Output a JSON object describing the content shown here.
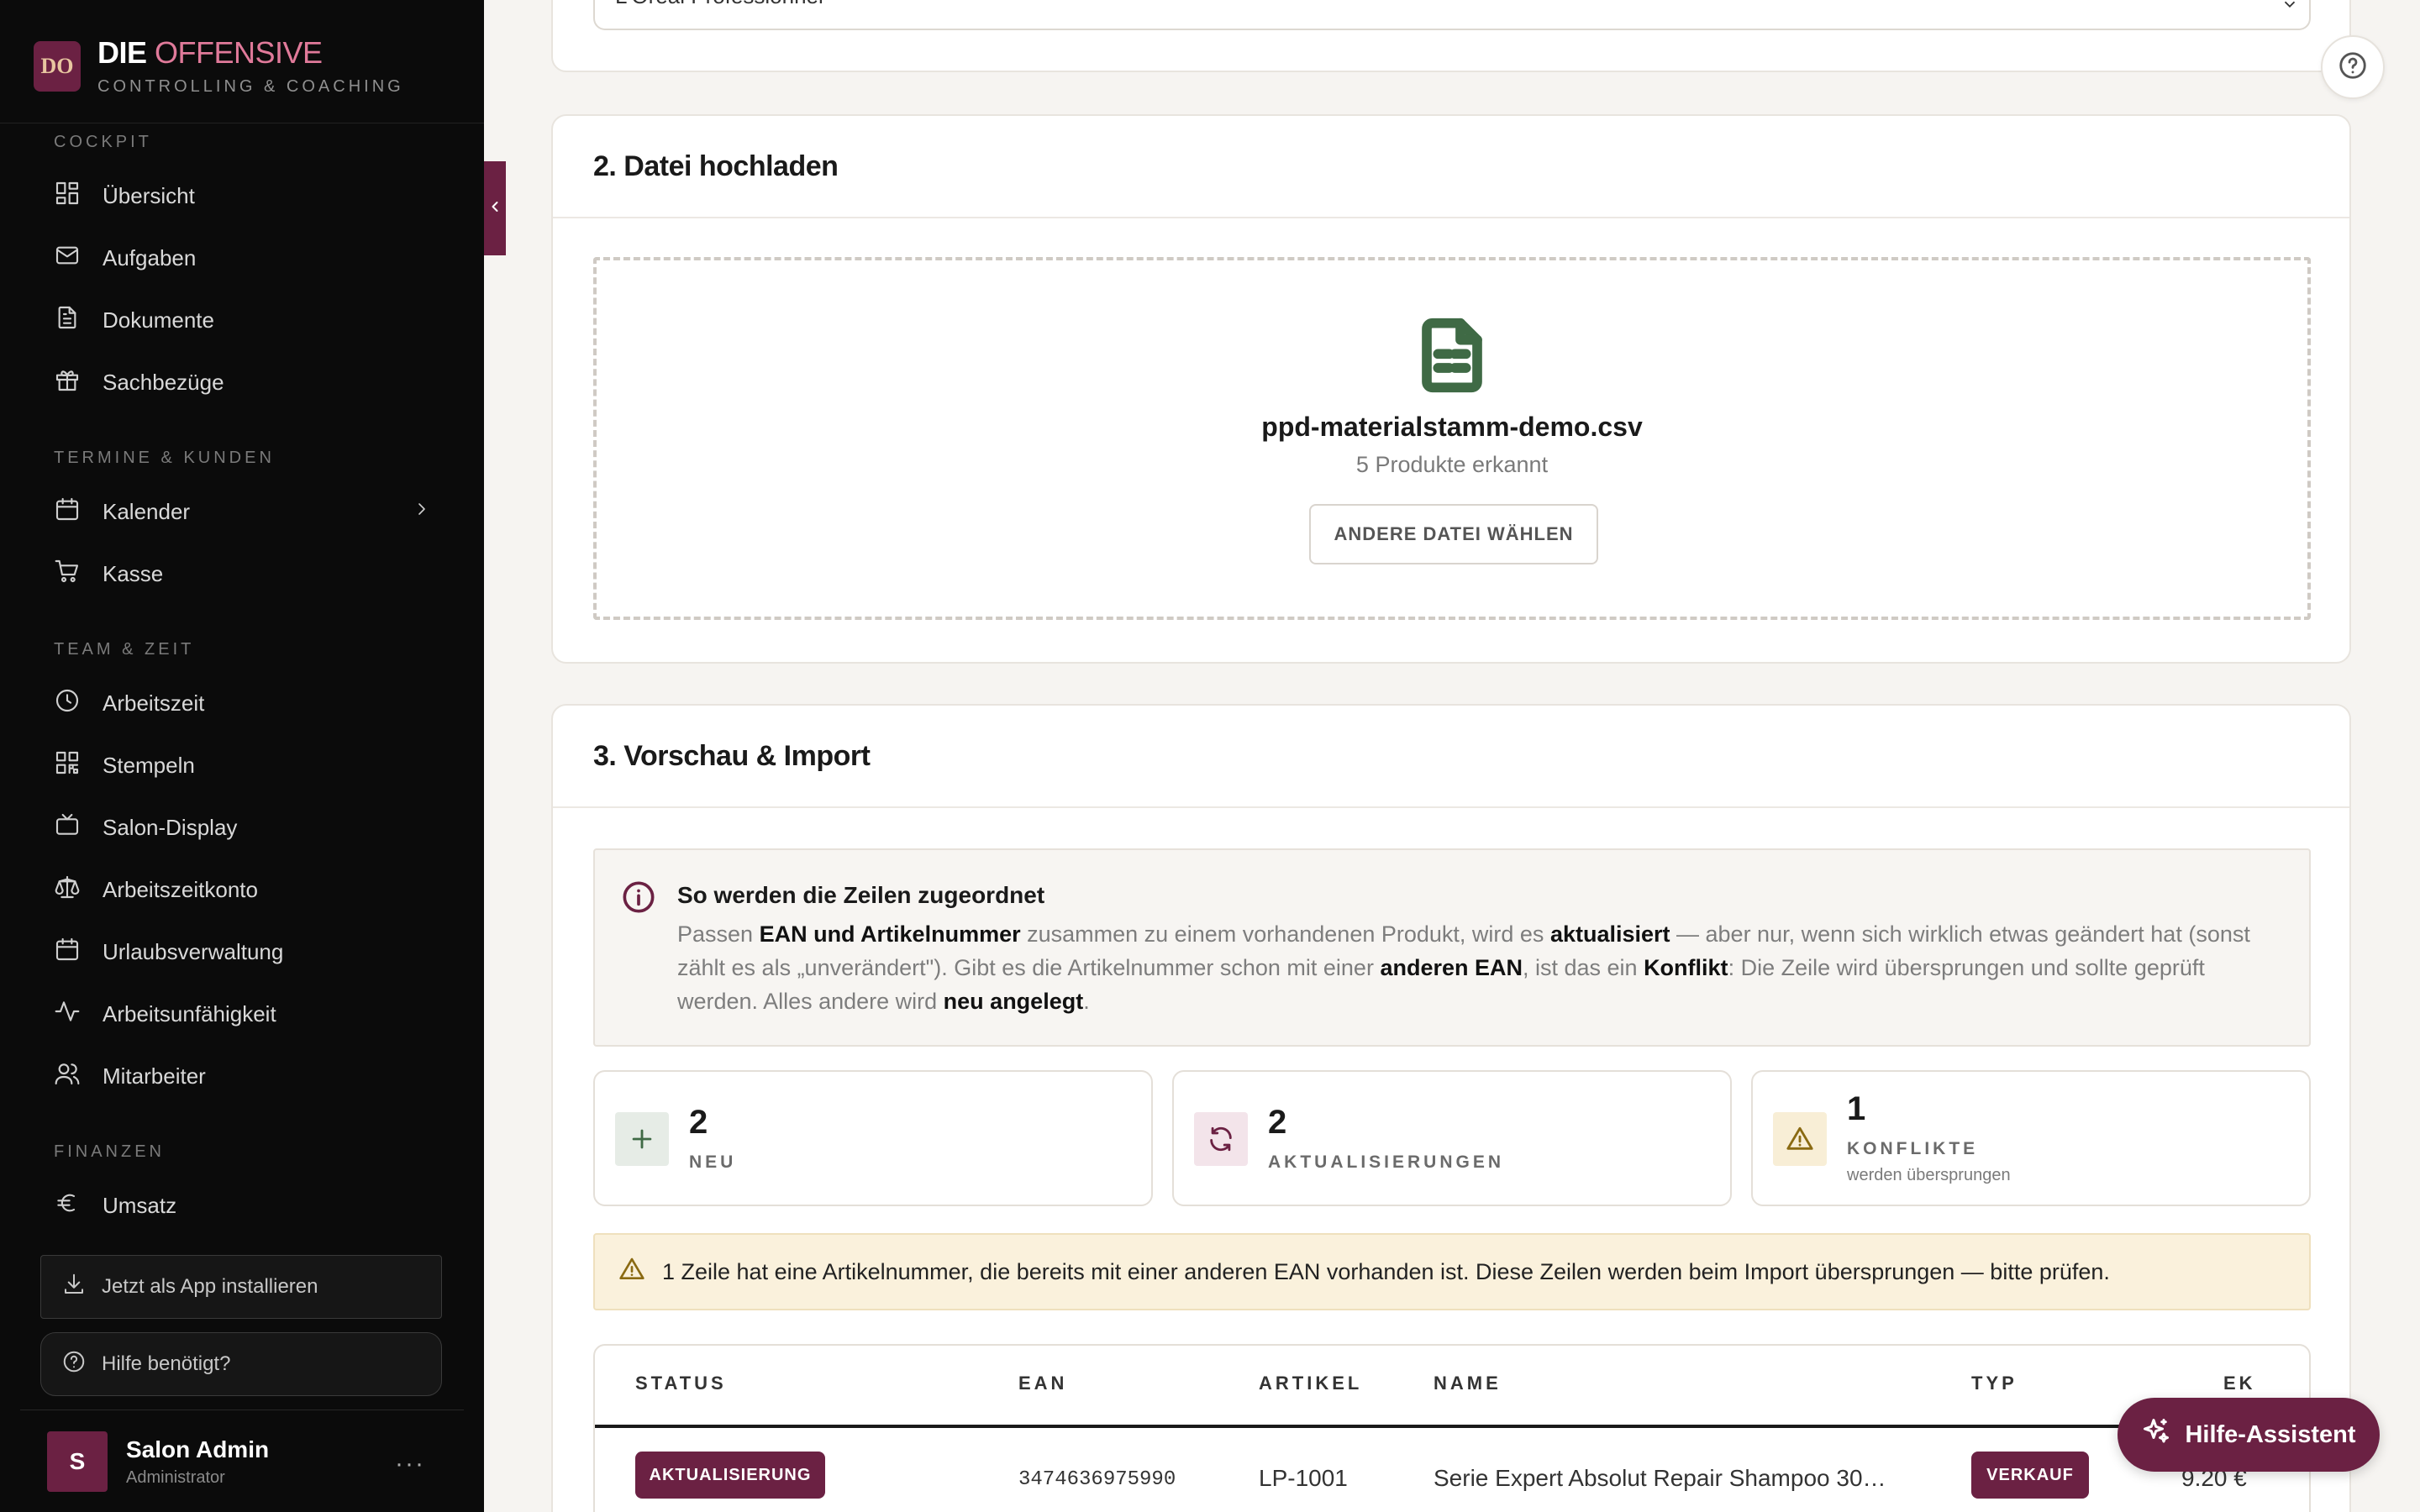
{
  "brand": {
    "title_1": "DIE",
    "title_2": "OFFENSIVE",
    "subtitle": "CONTROLLING & COACHING",
    "logo": "DO"
  },
  "sidebar": {
    "sections": [
      {
        "title": "COCKPIT"
      },
      {
        "title": "TERMINE & KUNDEN"
      },
      {
        "title": "TEAM & ZEIT"
      },
      {
        "title": "FINANZEN"
      }
    ],
    "items": [
      {
        "label": "Übersicht",
        "icon": "dashboard-icon"
      },
      {
        "label": "Aufgaben",
        "icon": "mail-icon"
      },
      {
        "label": "Dokumente",
        "icon": "document-icon"
      },
      {
        "label": "Sachbezüge",
        "icon": "gift-icon"
      },
      {
        "label": "Kalender",
        "icon": "calendar-icon"
      },
      {
        "label": "Kasse",
        "icon": "cart-icon"
      },
      {
        "label": "Arbeitszeit",
        "icon": "clock-icon"
      },
      {
        "label": "Stempeln",
        "icon": "qr-icon"
      },
      {
        "label": "Salon-Display",
        "icon": "tv-icon"
      },
      {
        "label": "Arbeitszeitkonto",
        "icon": "scale-icon"
      },
      {
        "label": "Urlaubsverwaltung",
        "icon": "calendar-icon"
      },
      {
        "label": "Arbeitsunfähigkeit",
        "icon": "activity-icon"
      },
      {
        "label": "Mitarbeiter",
        "icon": "users-icon"
      },
      {
        "label": "Umsatz",
        "icon": "euro-icon"
      }
    ],
    "install_label": "Jetzt als App installieren",
    "help_label": "Hilfe benötigt?"
  },
  "user": {
    "initial": "S",
    "name": "Salon Admin",
    "role": "Administrator",
    "more": "···"
  },
  "supplier_select": {
    "value": "L'Oréal Professionnel"
  },
  "upload": {
    "title": "2. Datei hochladen",
    "file_name": "ppd-materialstamm-demo.csv",
    "file_count": "5 Produkte erkannt",
    "other_file_label": "ANDERE DATEI WÄHLEN"
  },
  "preview": {
    "title": "3. Vorschau & Import",
    "info_title": "So werden die Zeilen zugeordnet",
    "info": {
      "t1": "Passen ",
      "b1": "EAN und Artikelnummer",
      "t2": " zusammen zu einem vorhandenen Produkt, wird es ",
      "b2": "aktualisiert",
      "t3": " — aber nur, wenn sich wirklich etwas geändert hat (sonst zählt es als „unverändert\"). Gibt es die Artikelnummer schon mit einer ",
      "b3": "anderen EAN",
      "t4": ", ist das ein ",
      "b4": "Konflikt",
      "t5": ": Die Zeile wird übersprungen und sollte geprüft werden. Alles andere wird ",
      "b5": "neu angelegt",
      "t6": "."
    },
    "stats": [
      {
        "count": "2",
        "label": "NEU",
        "sub": "",
        "icon": "plus-icon",
        "color": "#3f6a45"
      },
      {
        "count": "2",
        "label": "AKTUALISIERUNGEN",
        "sub": "",
        "icon": "refresh-icon",
        "color": "#6b2143"
      },
      {
        "count": "1",
        "label": "KONFLIKTE",
        "sub": "werden übersprungen",
        "icon": "warning-icon",
        "color": "#8a6a12"
      }
    ],
    "warning": "1 Zeile hat eine Artikelnummer, die bereits mit einer anderen EAN vorhanden ist. Diese Zeilen werden beim Import übersprungen — bitte prüfen.",
    "table": {
      "headers": [
        "STATUS",
        "EAN",
        "ARTIKEL",
        "NAME",
        "TYP",
        "EK"
      ],
      "rows": [
        {
          "status": "AKTUALISIERUNG",
          "ean": "3474636975990",
          "artikel": "LP-1001",
          "name": "Serie Expert Absolut Repair Shampoo 30…",
          "typ": "VERKAUF",
          "ek": "9.20 €"
        }
      ]
    }
  },
  "assistant_label": "Hilfe-Assistent",
  "colors": {
    "brand": "#6b2143",
    "sidebar_bg": "#0b0b0b",
    "page_bg": "#f6f4f1"
  }
}
